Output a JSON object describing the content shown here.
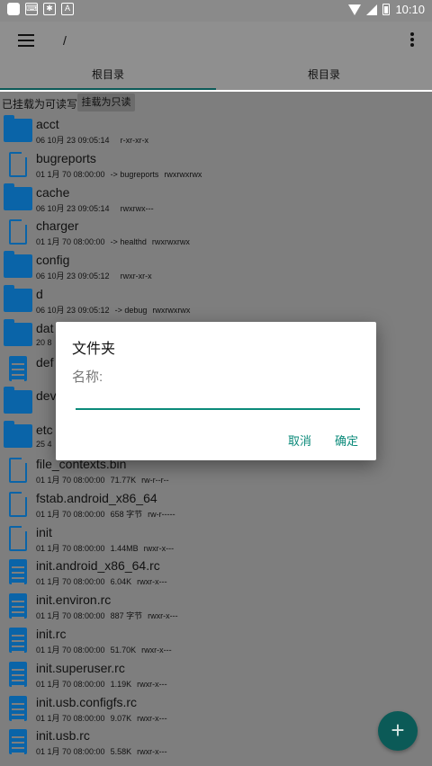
{
  "status": {
    "time": "10:10"
  },
  "appbar": {
    "path": "/"
  },
  "tabs": [
    {
      "label": "根目录"
    },
    {
      "label": "根目录"
    }
  ],
  "mount": {
    "text": "已挂载为可读写",
    "button": "挂载为只读"
  },
  "files": [
    {
      "name": "acct",
      "type": "folder",
      "date": "06 10月 23 09:05:14",
      "info": "",
      "perm": "r-xr-xr-x"
    },
    {
      "name": "bugreports",
      "type": "file",
      "date": "01 1月 70 08:00:00",
      "info": "-> bugreports",
      "perm": "rwxrwxrwx"
    },
    {
      "name": "cache",
      "type": "folder",
      "date": "06 10月 23 09:05:14",
      "info": "",
      "perm": "rwxrwx---"
    },
    {
      "name": "charger",
      "type": "file",
      "date": "01 1月 70 08:00:00",
      "info": "-> healthd",
      "perm": "rwxrwxrwx"
    },
    {
      "name": "config",
      "type": "folder",
      "date": "06 10月 23 09:05:12",
      "info": "",
      "perm": "rwxr-xr-x"
    },
    {
      "name": "d",
      "type": "folder",
      "date": "06 10月 23 09:05:12",
      "info": "-> debug",
      "perm": "rwxrwxrwx"
    },
    {
      "name": "dat",
      "type": "folder",
      "date": "20 8",
      "info": "",
      "perm": ""
    },
    {
      "name": "def",
      "type": "doc",
      "date": "",
      "info": "",
      "perm": ""
    },
    {
      "name": "dev",
      "type": "folder",
      "date": "",
      "info": "",
      "perm": ""
    },
    {
      "name": "etc",
      "type": "folder",
      "date": "25 4",
      "info": "",
      "perm": ""
    },
    {
      "name": "file_contexts.bin",
      "type": "file",
      "date": "01 1月 70 08:00:00",
      "info": "71.77K",
      "perm": "rw-r--r--"
    },
    {
      "name": "fstab.android_x86_64",
      "type": "file",
      "date": "01 1月 70 08:00:00",
      "info": "658 字节",
      "perm": "rw-r-----"
    },
    {
      "name": "init",
      "type": "file",
      "date": "01 1月 70 08:00:00",
      "info": "1.44MB",
      "perm": "rwxr-x---"
    },
    {
      "name": "init.android_x86_64.rc",
      "type": "doc",
      "date": "01 1月 70 08:00:00",
      "info": "6.04K",
      "perm": "rwxr-x---"
    },
    {
      "name": "init.environ.rc",
      "type": "doc",
      "date": "01 1月 70 08:00:00",
      "info": "887 字节",
      "perm": "rwxr-x---"
    },
    {
      "name": "init.rc",
      "type": "doc",
      "date": "01 1月 70 08:00:00",
      "info": "51.70K",
      "perm": "rwxr-x---"
    },
    {
      "name": "init.superuser.rc",
      "type": "doc",
      "date": "01 1月 70 08:00:00",
      "info": "1.19K",
      "perm": "rwxr-x---"
    },
    {
      "name": "init.usb.configfs.rc",
      "type": "doc",
      "date": "01 1月 70 08:00:00",
      "info": "9.07K",
      "perm": "rwxr-x---"
    },
    {
      "name": "init.usb.rc",
      "type": "doc",
      "date": "01 1月 70 08:00:00",
      "info": "5.58K",
      "perm": "rwxr-x---"
    }
  ],
  "dialog": {
    "title": "文件夹",
    "label": "名称:",
    "input_value": "",
    "cancel": "取消",
    "ok": "确定"
  },
  "fab": {
    "label": "+"
  },
  "colors": {
    "accent": "#0b8a7a",
    "folder": "#0a64a8",
    "fab": "#0b5a57"
  }
}
